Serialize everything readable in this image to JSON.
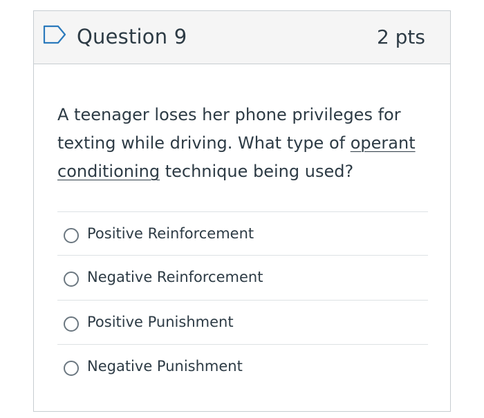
{
  "question": {
    "title": "Question 9",
    "points": "2 pts",
    "text_before": "A teenager loses her phone privileges for texting while driving. What type of ",
    "term_1": "operant",
    "term_2": "conditioning",
    "text_after": " technique being used?",
    "flag_icon": "bookmark-flag-outline"
  },
  "answers": [
    {
      "label": "Positive Reinforcement",
      "selected": false
    },
    {
      "label": "Negative Reinforcement",
      "selected": false
    },
    {
      "label": "Positive Punishment",
      "selected": false
    },
    {
      "label": "Negative Punishment",
      "selected": false
    }
  ],
  "colors": {
    "text": "#2d3b45",
    "header_bg": "#f5f5f5",
    "border": "#c7cdd1",
    "divider": "#dde2e4",
    "flag": "#2b7abc"
  }
}
